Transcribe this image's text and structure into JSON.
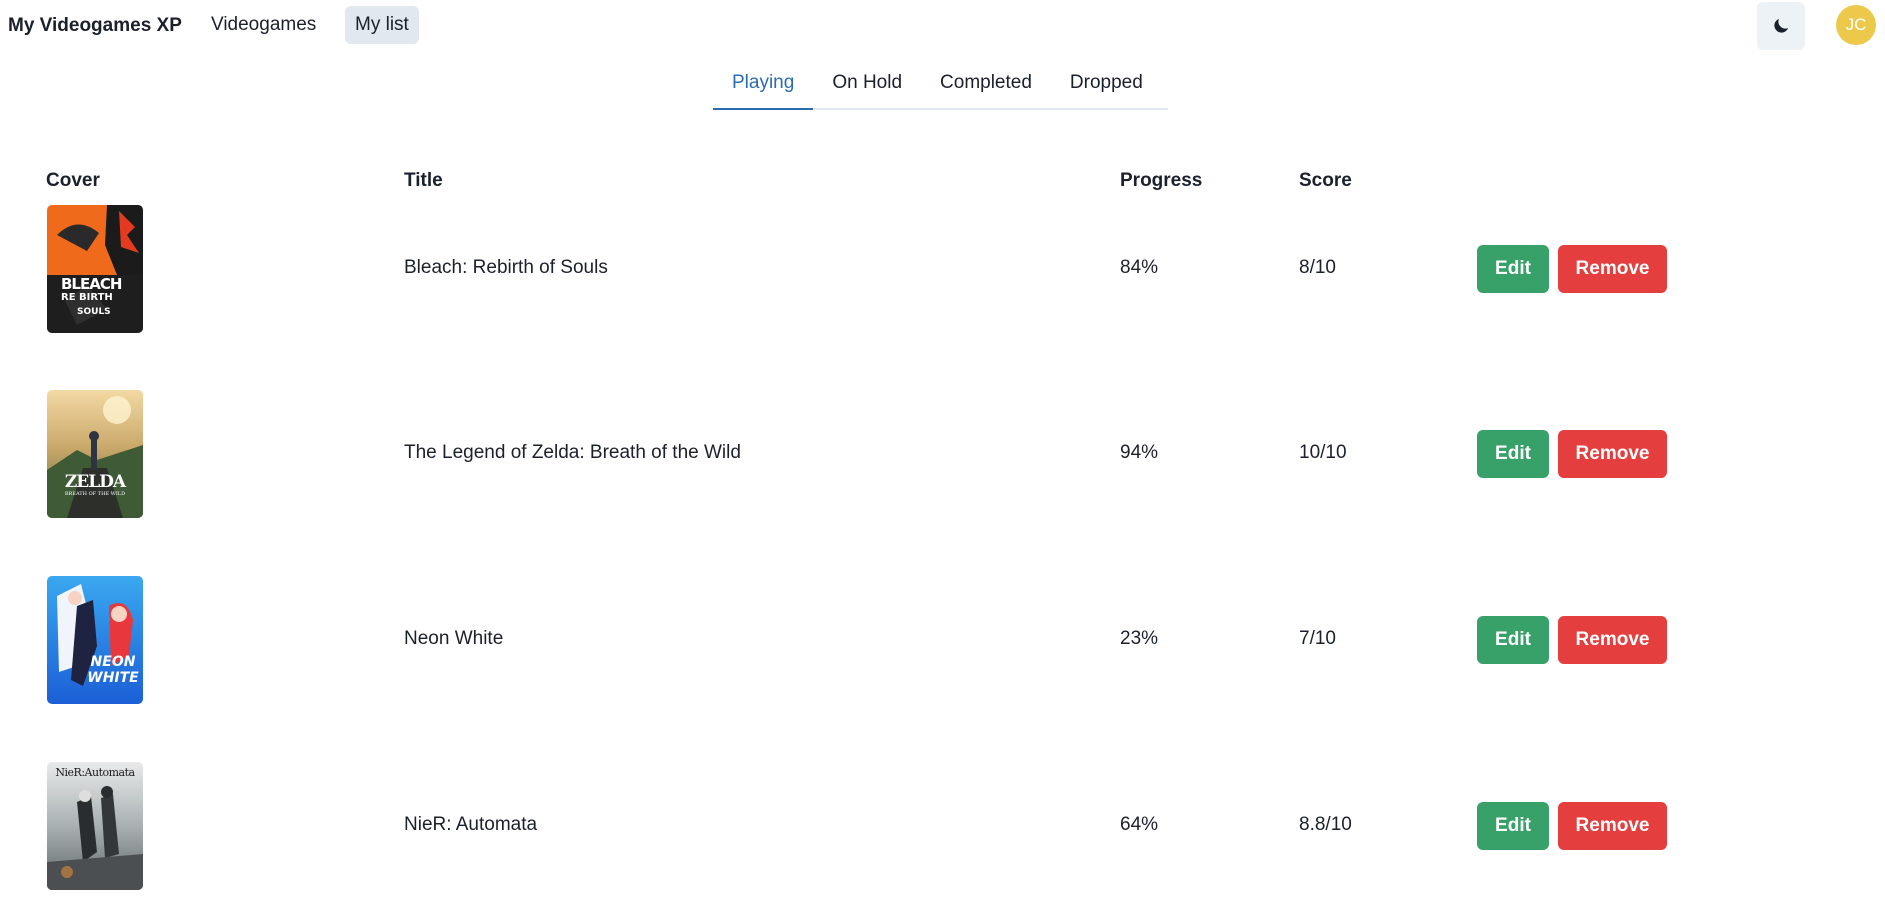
{
  "nav": {
    "brand": "My Videogames XP",
    "links": [
      {
        "label": "Videogames"
      },
      {
        "label": "My list",
        "active": true
      }
    ],
    "theme_toggle_icon": "moon-icon",
    "avatar_initials": "JC",
    "avatar_color": "#ecc94b"
  },
  "tabs": [
    {
      "label": "Playing",
      "selected": true
    },
    {
      "label": "On Hold"
    },
    {
      "label": "Completed"
    },
    {
      "label": "Dropped"
    }
  ],
  "table": {
    "headers": {
      "cover": "Cover",
      "title": "Title",
      "progress": "Progress",
      "score": "Score"
    },
    "rows": [
      {
        "title": "Bleach: Rebirth of Souls",
        "progress": "84%",
        "score": "8/10",
        "cover_text": [
          "BLEACH",
          "RE BIRTH",
          "SOULS"
        ],
        "edit": "Edit",
        "remove": "Remove"
      },
      {
        "title": "The Legend of Zelda: Breath of the Wild",
        "progress": "94%",
        "score": "10/10",
        "cover_text": [
          "ZELDA",
          "BREATH OF THE WILD"
        ],
        "edit": "Edit",
        "remove": "Remove"
      },
      {
        "title": "Neon White",
        "progress": "23%",
        "score": "7/10",
        "cover_text": [
          "NEON",
          "WHITE"
        ],
        "edit": "Edit",
        "remove": "Remove"
      },
      {
        "title": "NieR: Automata",
        "progress": "64%",
        "score": "8.8/10",
        "cover_text": [
          "NieR:Automata"
        ],
        "edit": "Edit",
        "remove": "Remove"
      }
    ]
  },
  "colors": {
    "edit_button": "#38a169",
    "remove_button": "#e53e3e",
    "tab_selected": "#2b6cb0",
    "nav_active_bg": "#e2e8f0"
  }
}
